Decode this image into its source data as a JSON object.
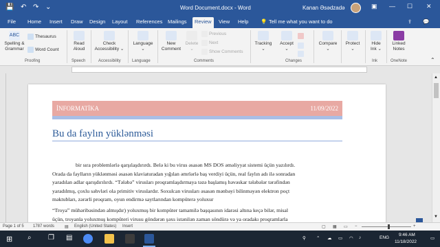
{
  "window": {
    "title": "Word Document.docx  -  Word",
    "user_name": "Kanan Əsədzadə",
    "minimize": "—",
    "maximize": "☐",
    "close": "✕"
  },
  "quick_access": {
    "save": "💾",
    "undo": "↶",
    "redo": "↷",
    "more": "⌄"
  },
  "tabs": [
    "File",
    "Home",
    "Insert",
    "Draw",
    "Design",
    "Layout",
    "References",
    "Mailings",
    "Review",
    "View",
    "Help"
  ],
  "active_tab": "Review",
  "tell_me": "Tell me what you want to do",
  "ribbon": {
    "spelling": "Spelling &",
    "spelling2": "Grammar",
    "thesaurus": "Thesaurus",
    "word_count": "Word Count",
    "read_aloud": "Read",
    "read_aloud2": "Aloud",
    "check_access": "Check",
    "check_access2": "Accessibility ⌄",
    "language": "Language",
    "language2": "⌄",
    "new_comment": "New",
    "new_comment2": "Comment",
    "delete": "Delete",
    "delete2": "⌄",
    "previous": "Previous",
    "next": "Next",
    "show_comments": "Show Comments",
    "tracking": "Tracking",
    "tracking2": "⌄",
    "accept": "Accept",
    "accept2": "⌄",
    "compare": "Compare",
    "compare2": "⌄",
    "protect": "Protect",
    "protect2": "⌄",
    "hide_ink": "Hide",
    "hide_ink2": "Ink ⌄",
    "linked_notes": "Linked",
    "linked_notes2": "Notes",
    "groups": [
      "Proofing",
      "Speech",
      "Accessibility",
      "Language",
      "Comments",
      "Changes",
      "Ink",
      "OneNote"
    ]
  },
  "document": {
    "banner_left": "İNFORMATİKA",
    "banner_right": "11/09/2022",
    "heading": "Bu da faylın yüklənməsi",
    "paragraph1": [
      "bir sıra problemlərlə qarşılaşdırırdı. Belə ki bu virus əsasən MS DOS əməliyyat sistemi üçün yazılırdı.",
      "Orada da faylların yüklənməsi əsasən klaviaturadan yığılan əmrlərlə baş verdiyi üçün, real faylın adı ilə sonradan",
      "yaradılan adlar qarışdırılırdı. “Tələbə” virusları proqramlaşdırmaya təzə başlamış həvəskar tələbələr tərəfindən",
      "yaradılmış, çoxlu səhvləri olа primitiv viruslardır. Soxulcan virusları əsasən mənbəyi bilinməyən elektron poçt",
      "məktubları, zərərli proqram, oyun endirmə saytlarından kompüterə yoluxur"
    ],
    "paragraph2": [
      "“Troya” mühəribəsindən almışdır) yoluxmuş bir kompüter tamamilə başqasının idarəsi altına keçə bilər, misal",
      "üçün, troyanla yoluxmuş kompüteri virusu göndərən şəxs istənilən zaman söndürə və ya oradakı proqramlarla"
    ]
  },
  "status_bar": {
    "page": "Page 1 of 5",
    "words": "1787 words",
    "language": "English (United States)",
    "mode": "Insert"
  },
  "taskbar": {
    "language": "ENG",
    "time": "9:46 AM",
    "date": "11/18/2022"
  }
}
